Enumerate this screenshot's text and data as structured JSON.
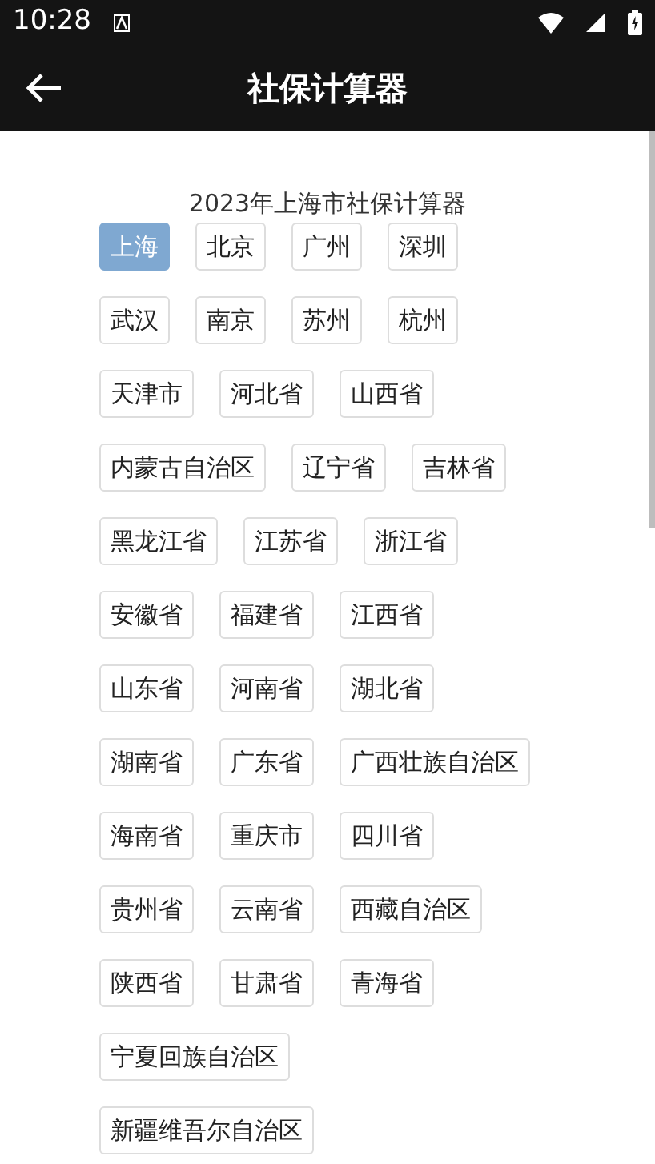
{
  "status_bar": {
    "time": "10:28"
  },
  "app_bar": {
    "title": "社保计算器"
  },
  "heading": "2023年上海市社保计算器",
  "rows": [
    [
      {
        "label": "上海",
        "selected": true
      },
      {
        "label": "北京",
        "selected": false
      },
      {
        "label": "广州",
        "selected": false
      },
      {
        "label": "深圳",
        "selected": false
      }
    ],
    [
      {
        "label": "武汉",
        "selected": false
      },
      {
        "label": "南京",
        "selected": false
      },
      {
        "label": "苏州",
        "selected": false
      },
      {
        "label": "杭州",
        "selected": false
      }
    ],
    [
      {
        "label": "天津市",
        "selected": false
      },
      {
        "label": "河北省",
        "selected": false
      },
      {
        "label": "山西省",
        "selected": false
      }
    ],
    [
      {
        "label": "内蒙古自治区",
        "selected": false
      },
      {
        "label": "辽宁省",
        "selected": false
      },
      {
        "label": "吉林省",
        "selected": false
      }
    ],
    [
      {
        "label": "黑龙江省",
        "selected": false
      },
      {
        "label": "江苏省",
        "selected": false
      },
      {
        "label": "浙江省",
        "selected": false
      }
    ],
    [
      {
        "label": "安徽省",
        "selected": false
      },
      {
        "label": "福建省",
        "selected": false
      },
      {
        "label": "江西省",
        "selected": false
      }
    ],
    [
      {
        "label": "山东省",
        "selected": false
      },
      {
        "label": "河南省",
        "selected": false
      },
      {
        "label": "湖北省",
        "selected": false
      }
    ],
    [
      {
        "label": "湖南省",
        "selected": false
      },
      {
        "label": "广东省",
        "selected": false
      },
      {
        "label": "广西壮族自治区",
        "selected": false
      }
    ],
    [
      {
        "label": "海南省",
        "selected": false
      },
      {
        "label": "重庆市",
        "selected": false
      },
      {
        "label": "四川省",
        "selected": false
      }
    ],
    [
      {
        "label": "贵州省",
        "selected": false
      },
      {
        "label": "云南省",
        "selected": false
      },
      {
        "label": "西藏自治区",
        "selected": false
      }
    ],
    [
      {
        "label": "陕西省",
        "selected": false
      },
      {
        "label": "甘肃省",
        "selected": false
      },
      {
        "label": "青海省",
        "selected": false
      }
    ],
    [
      {
        "label": "宁夏回族自治区",
        "selected": false
      }
    ],
    [
      {
        "label": "新疆维吾尔自治区",
        "selected": false
      }
    ]
  ]
}
